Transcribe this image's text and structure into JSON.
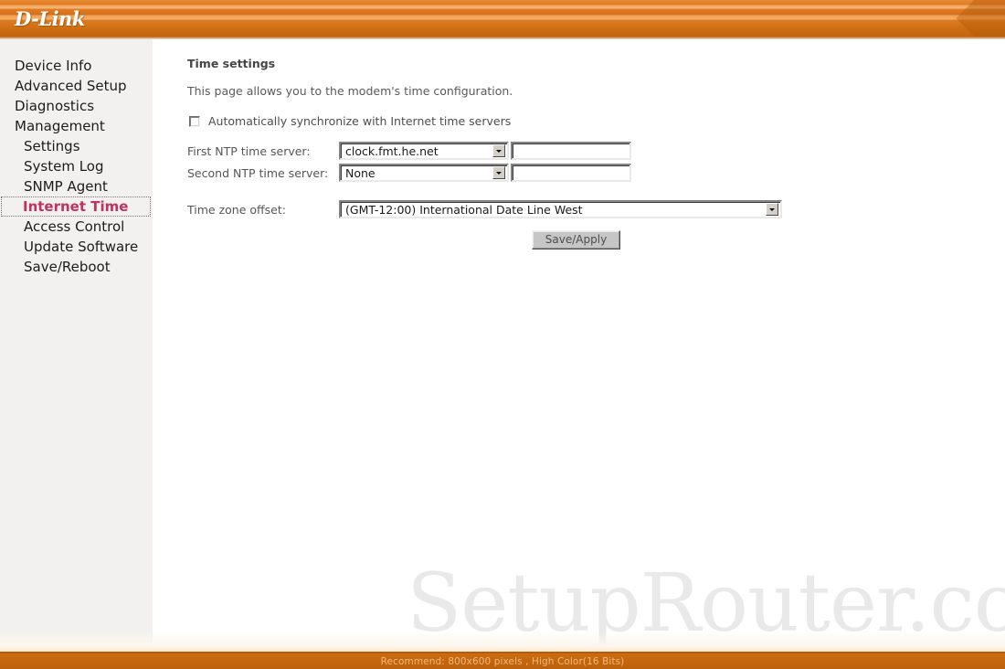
{
  "header": {
    "logo_text": "D-Link"
  },
  "sidebar": {
    "items": [
      {
        "label": "Device Info",
        "level": "top",
        "selected": false
      },
      {
        "label": "Advanced Setup",
        "level": "top",
        "selected": false
      },
      {
        "label": "Diagnostics",
        "level": "top",
        "selected": false
      },
      {
        "label": "Management",
        "level": "top",
        "selected": false
      },
      {
        "label": "Settings",
        "level": "sub",
        "selected": false
      },
      {
        "label": "System Log",
        "level": "sub",
        "selected": false
      },
      {
        "label": "SNMP Agent",
        "level": "sub",
        "selected": false
      },
      {
        "label": "Internet Time",
        "level": "sub",
        "selected": true
      },
      {
        "label": "Access Control",
        "level": "sub",
        "selected": false
      },
      {
        "label": "Update Software",
        "level": "sub",
        "selected": false
      },
      {
        "label": "Save/Reboot",
        "level": "sub",
        "selected": false
      }
    ]
  },
  "main": {
    "title": "Time settings",
    "description": "This page allows you to the modem's time configuration.",
    "auto_sync": {
      "label": "Automatically synchronize with Internet time servers",
      "checked": false
    },
    "fields": {
      "first_ntp": {
        "label": "First NTP time server:",
        "selected": "clock.fmt.he.net",
        "custom_value": "",
        "custom_placeholder": ""
      },
      "second_ntp": {
        "label": "Second NTP time server:",
        "selected": "None",
        "custom_value": "",
        "custom_placeholder": ""
      },
      "timezone": {
        "label": "Time zone offset:",
        "selected": "(GMT-12:00) International Date Line West"
      }
    },
    "save_button": "Save/Apply",
    "watermark": "SetupRouter.co"
  },
  "footer": {
    "text": "Recommend: 800x600 pixels , High Color(16 Bits)"
  },
  "colors": {
    "brand_orange": "#cc6c12",
    "selected_nav": "#c0315f",
    "sidebar_bg": "#f2f1f0",
    "footer_text": "#f0b97c"
  }
}
